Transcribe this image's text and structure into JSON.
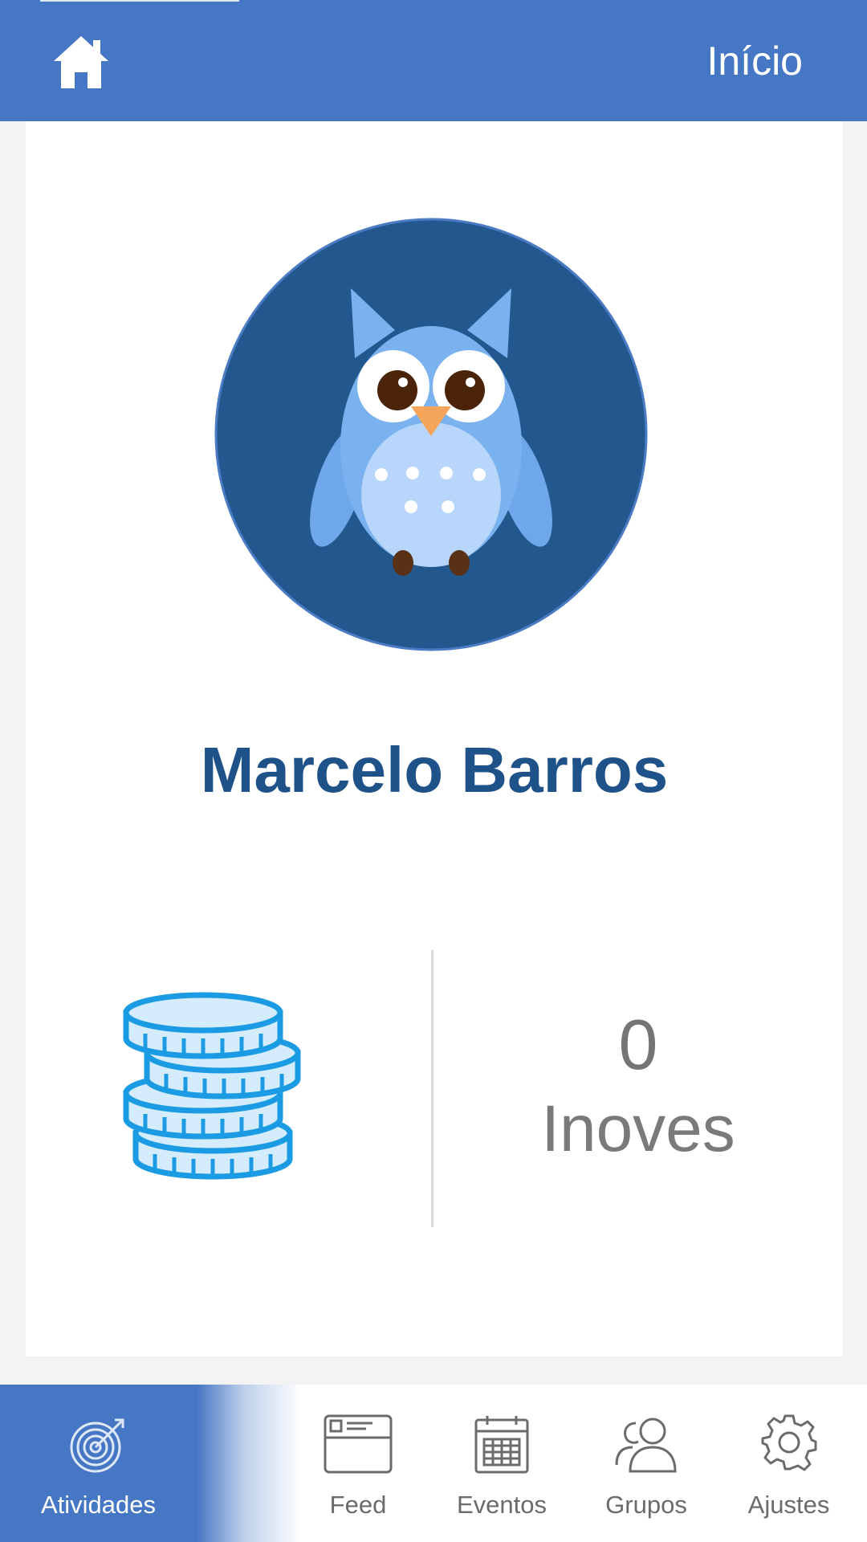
{
  "header": {
    "title": "Início",
    "icon": "home-icon",
    "background_color": "#4677c4"
  },
  "profile": {
    "avatar_icon": "owl-avatar",
    "name": "Marcelo Barros",
    "name_color": "#1e5289"
  },
  "stats": {
    "coins_icon": "coins-icon",
    "count": "0",
    "label": "Inoves"
  },
  "bottom_nav": {
    "items": [
      {
        "label": "Atividades",
        "icon": "target-icon",
        "active": true
      },
      {
        "label": "Feed",
        "icon": "feed-icon",
        "active": false
      },
      {
        "label": "Eventos",
        "icon": "calendar-icon",
        "active": false
      },
      {
        "label": "Grupos",
        "icon": "group-icon",
        "active": false
      },
      {
        "label": "Ajustes",
        "icon": "gear-icon",
        "active": false
      }
    ]
  }
}
